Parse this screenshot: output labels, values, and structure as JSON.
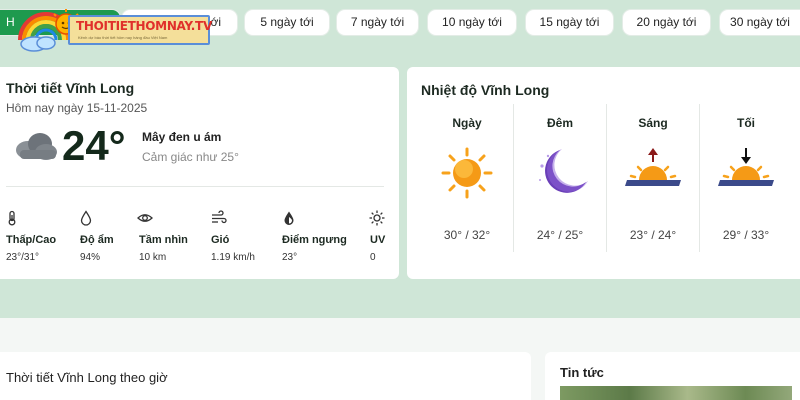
{
  "tabs": {
    "active_label": "H",
    "partial_label": "ới",
    "items": [
      "5 ngày tới",
      "7 ngày tới",
      "10 ngày tới",
      "15 ngày tới",
      "20 ngày tới",
      "30 ngày tới"
    ]
  },
  "logo": {
    "text": "THOITIETHOMNAY.TV",
    "tagline": "Kênh dự báo thời tiết hôm nay hàng đầu Việt Nam"
  },
  "current": {
    "title": "Thời tiết Vĩnh Long",
    "date": "Hôm nay ngày 15-11-2025",
    "temperature": "24°",
    "condition": "Mây đen u ám",
    "feels_like": "Cảm giác như 25°",
    "icon": "cloud-icon",
    "stats": [
      {
        "label": "Thấp/Cao",
        "value": "23°/31°",
        "icon": "thermometer-icon"
      },
      {
        "label": "Độ ẩm",
        "value": "94%",
        "icon": "droplet-icon"
      },
      {
        "label": "Tầm nhìn",
        "value": "10 km",
        "icon": "eye-icon"
      },
      {
        "label": "Gió",
        "value": "1.19 km/h",
        "icon": "wind-icon"
      },
      {
        "label": "Điểm ngưng",
        "value": "23°",
        "icon": "dewpoint-icon"
      },
      {
        "label": "UV",
        "value": "0",
        "icon": "sun-outline-icon"
      }
    ]
  },
  "temps": {
    "title": "Nhiệt độ Vĩnh Long",
    "columns": [
      {
        "label": "Ngày",
        "range": "30° / 32°",
        "icon": "sun-icon"
      },
      {
        "label": "Đêm",
        "range": "24° / 25°",
        "icon": "moon-icon"
      },
      {
        "label": "Sáng",
        "range": "23° / 24°",
        "icon": "sunrise-icon"
      },
      {
        "label": "Tối",
        "range": "29° / 33°",
        "icon": "sunset-icon"
      }
    ]
  },
  "hourly": {
    "title": "Thời tiết Vĩnh Long theo giờ"
  },
  "news": {
    "title": "Tin tức"
  },
  "colors": {
    "page_bg": "#cfe6d7",
    "accent_green": "#1e9a4e",
    "sun_orange": "#f7a21b",
    "moon_purple": "#6a3fb8",
    "logo_red": "#e0302b"
  }
}
